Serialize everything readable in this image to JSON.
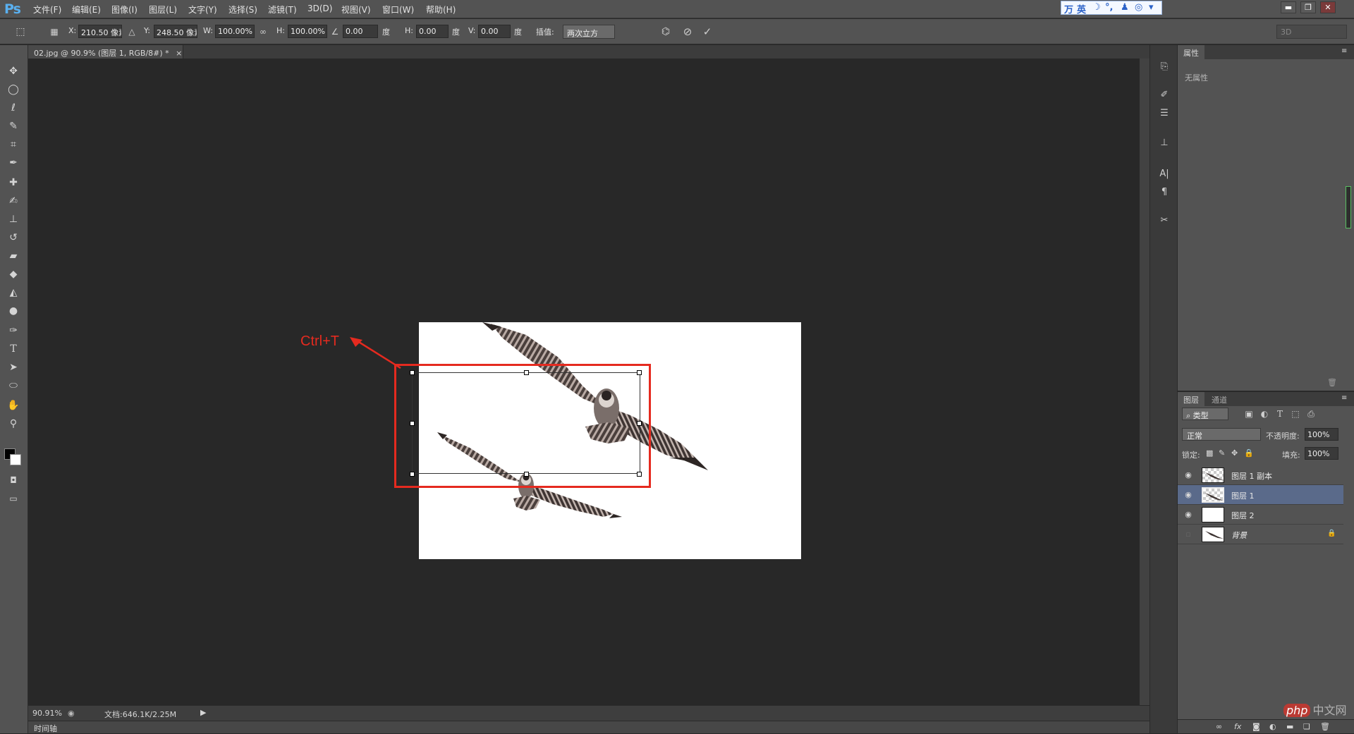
{
  "app": {
    "logo": "Ps"
  },
  "menu": [
    "文件(F)",
    "编辑(E)",
    "图像(I)",
    "图层(L)",
    "文字(Y)",
    "选择(S)",
    "滤镜(T)",
    "3D(D)",
    "视图(V)",
    "窗口(W)",
    "帮助(H)"
  ],
  "ime": {
    "chips": [
      "万",
      "英",
      "☽",
      "°,",
      "♟",
      "◎",
      "▾"
    ]
  },
  "window_controls": {
    "minimize": "▬",
    "restore": "❐",
    "close": "✕"
  },
  "options": {
    "x_label": "X:",
    "x_value": "210.50 像素",
    "y_label": "Y:",
    "y_value": "248.50 像素",
    "w_label": "W:",
    "w_value": "100.00%",
    "h_label": "H:",
    "h_value": "100.00%",
    "angle_value": "0.00",
    "angle_unit": "度",
    "hskew_label": "H:",
    "hskew_value": "0.00",
    "hskew_unit": "度",
    "vskew_label": "V:",
    "vskew_value": "0.00",
    "vskew_unit": "度",
    "interp_label": "插值:",
    "interp_value": "两次立方",
    "workspace_value": "3D"
  },
  "document": {
    "tab_label": "02.jpg @ 90.9% (图层 1, RGB/8#) *",
    "close": "×"
  },
  "annotation": {
    "text": "Ctrl+T",
    "color": "#e52a1f"
  },
  "status": {
    "zoom": "90.91%",
    "doc_info": "文档:646.1K/2.25M",
    "timeline": "时间轴"
  },
  "properties_panel": {
    "tab": "属性",
    "empty_text": "无属性"
  },
  "layers_panel": {
    "tabs": [
      "图层",
      "通道"
    ],
    "filter_label": "类型",
    "blend_mode": "正常",
    "opacity_label": "不透明度:",
    "opacity_value": "100%",
    "lock_label": "锁定:",
    "fill_label": "填充:",
    "fill_value": "100%",
    "layers": [
      {
        "name": "图层 1 副本",
        "visible": true,
        "selected": false,
        "thumb": "bird-transparent"
      },
      {
        "name": "图层 1",
        "visible": true,
        "selected": true,
        "thumb": "bird-transparent"
      },
      {
        "name": "图层 2",
        "visible": true,
        "selected": false,
        "thumb": "white"
      },
      {
        "name": "背景",
        "visible": false,
        "selected": false,
        "thumb": "bird-white",
        "locked": true
      }
    ]
  },
  "watermark": {
    "text": "php",
    "suffix": "中文网"
  }
}
